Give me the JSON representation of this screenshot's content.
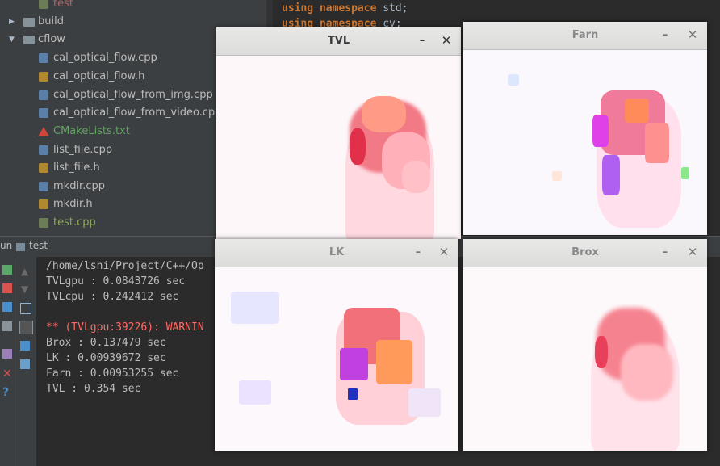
{
  "project_tree": {
    "items": [
      {
        "label": "test",
        "type": "test"
      },
      {
        "label": "build",
        "type": "folder"
      },
      {
        "label": "cflow",
        "type": "folder"
      },
      {
        "label": "cal_optical_flow.cpp",
        "type": "cpp"
      },
      {
        "label": "cal_optical_flow.h",
        "type": "h"
      },
      {
        "label": "cal_optical_flow_from_img.cpp",
        "type": "cpp"
      },
      {
        "label": "cal_optical_flow_from_video.cpp",
        "type": "cpp"
      },
      {
        "label": "CMakeLists.txt",
        "type": "cmake"
      },
      {
        "label": "list_file.cpp",
        "type": "cpp"
      },
      {
        "label": "list_file.h",
        "type": "h"
      },
      {
        "label": "mkdir.cpp",
        "type": "cpp"
      },
      {
        "label": "mkdir.h",
        "type": "h"
      },
      {
        "label": "test.cpp",
        "type": "test"
      }
    ]
  },
  "editor": {
    "lines": [
      {
        "keyword": "using namespace",
        "rest": " std;"
      },
      {
        "keyword": "using namespace",
        "rest": " cv;"
      }
    ]
  },
  "run_panel": {
    "tab_prefix": "un",
    "tab_label": "test"
  },
  "console": {
    "lines": [
      {
        "text": "/home/lshi/Project/C++/Op",
        "kind": "normal"
      },
      {
        "text": "TVLgpu : 0.0843726 sec",
        "kind": "normal"
      },
      {
        "text": "TVLcpu : 0.242412 sec",
        "kind": "normal"
      },
      {
        "text": "** (TVLgpu:39226): WARNIN",
        "kind": "warn"
      },
      {
        "text": "Brox : 0.137479 sec",
        "kind": "normal"
      },
      {
        "text": "LK : 0.00939672 sec",
        "kind": "normal"
      },
      {
        "text": "Farn : 0.00953255 sec",
        "kind": "normal"
      },
      {
        "text": "TVL : 0.354 sec",
        "kind": "normal"
      }
    ]
  },
  "windows": {
    "tvl": {
      "title": "TVL",
      "minimize": "–",
      "close": "✕"
    },
    "farn": {
      "title": "Farn",
      "minimize": "–",
      "close": "✕"
    },
    "lk": {
      "title": "LK",
      "minimize": "–",
      "close": "✕"
    },
    "brox": {
      "title": "Brox",
      "minimize": "–",
      "close": "✕"
    }
  },
  "colors": {
    "ide_bg": "#2b2b2b",
    "panel_bg": "#3c3f41",
    "keyword": "#cc7832",
    "warning": "#ff6b68",
    "flow_red": "#f0505a",
    "flow_pink": "#ff9ab0",
    "flow_magenta": "#e040e8",
    "flow_orange": "#ff8a5a"
  }
}
